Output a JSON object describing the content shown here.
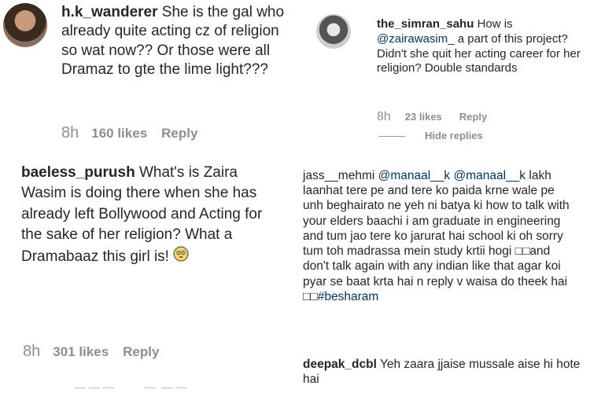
{
  "c1": {
    "username": "h.k_wanderer",
    "text": "She is the gal who already quite acting cz of religion so wat now?? Or those were all Dramaz to gte the lime light???",
    "time": "8h",
    "likes": "160 likes",
    "reply": "Reply"
  },
  "c2": {
    "username": "the_simran_sahu",
    "text_a": "How is",
    "mention": "@zairawasim_",
    "text_b": "a part of this project? Didn't she quit her acting career for her religion? Double standards",
    "time": "8h",
    "likes": "23 likes",
    "reply": "Reply",
    "hide_replies": "Hide replies"
  },
  "c3": {
    "username": "baeless_purush",
    "text": "What's is Zaira Wasim is doing there when she has already left Bollywood and Acting for the sake of her religion? What a Dramabaaz this girl is!",
    "time": "8h",
    "likes": "301 likes",
    "reply": "Reply"
  },
  "c4": {
    "username": "jass__mehmi",
    "mention_1": "@manaal__k",
    "mention_2": "@manaal__k",
    "text_a": "lakh laanhat tere pe and tere ko paida krne wale pe unh beghairato ne yeh ni batya ki how to talk with your elders baachi i am graduate in engineering and tum jao tere ko jarurat hai school ki oh sorry tum toh madrassa mein study krtii hogi",
    "boxes_1": "□□",
    "text_b": "and don't talk again with any indian like that agar koi pyar se baat krta hai n reply v waisa do theek hai",
    "boxes_2": "□□",
    "hashtag": "#besharam"
  },
  "c5": {
    "username": "deepak_dcbl",
    "text": "Yeh zaara jjaise mussale aise hi hote hai"
  }
}
